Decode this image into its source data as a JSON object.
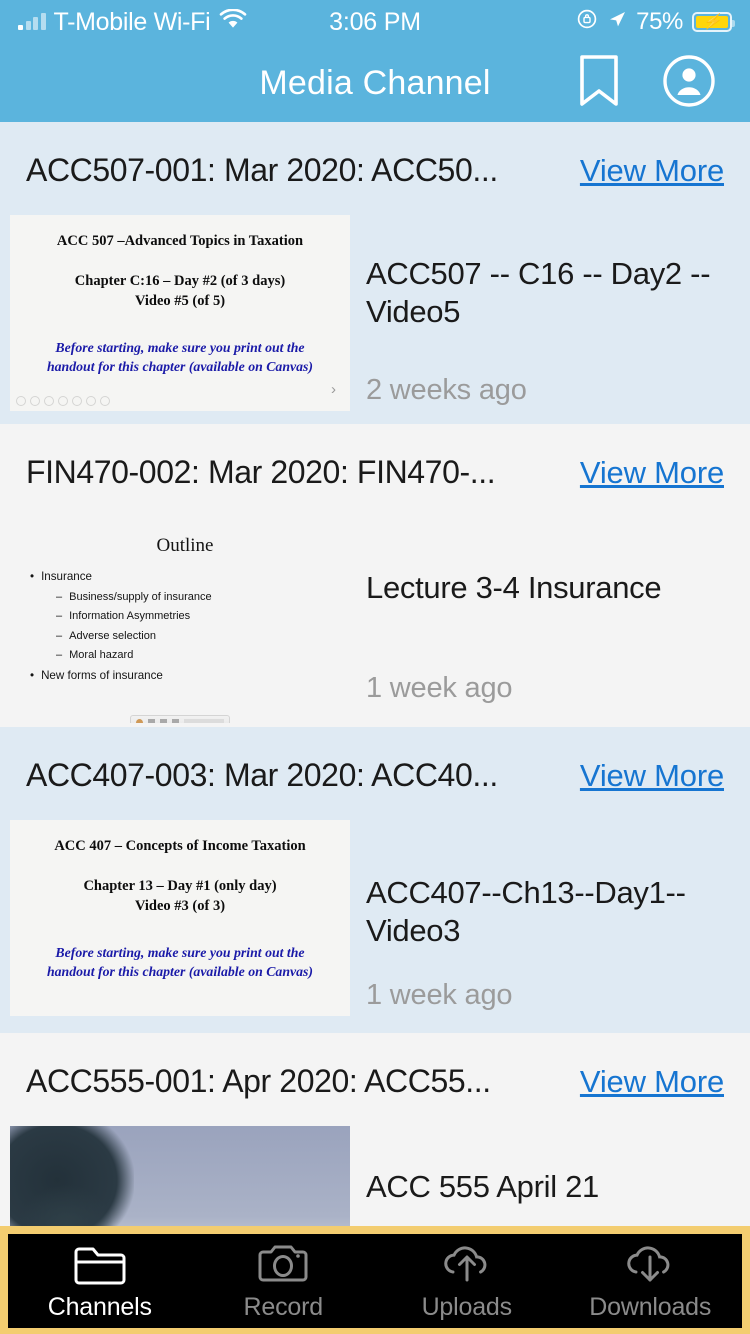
{
  "status_bar": {
    "carrier": "T-Mobile Wi-Fi",
    "time": "3:06 PM",
    "battery_percent": "75%",
    "icons": [
      "signal-bars-icon",
      "wifi-icon",
      "rotation-lock-icon",
      "location-arrow-icon",
      "battery-charging-icon"
    ]
  },
  "nav": {
    "title": "Media Channel",
    "bookmark_icon": "bookmark-icon",
    "account_icon": "account-avatar-icon"
  },
  "cards": [
    {
      "title": "ACC507-001: Mar 2020: ACC50...",
      "view_more": "View More",
      "video_title": "ACC507 -- C16 -- Day2 -- Video5",
      "age": "2 weeks ago",
      "thumb_type": "slide",
      "slide": {
        "line1": "ACC 507 –Advanced Topics in Taxation",
        "line2": "Chapter C:16 – Day #2 (of 3 days)",
        "line3": "Video #5 (of 5)",
        "note_line1": "Before starting, make sure you print out the",
        "note_line2": "handout for this chapter (available on Canvas)"
      }
    },
    {
      "title": "FIN470-002: Mar 2020: FIN470-...",
      "view_more": "View More",
      "video_title": "Lecture 3-4 Insurance",
      "age": "1 week ago",
      "thumb_type": "outline",
      "outline": {
        "heading": "Outline",
        "items": [
          {
            "text": "Insurance",
            "level": 1
          },
          {
            "text": "Business/supply of insurance",
            "level": 2
          },
          {
            "text": "Information Asymmetries",
            "level": 2
          },
          {
            "text": "Adverse selection",
            "level": 2
          },
          {
            "text": "Moral hazard",
            "level": 2
          },
          {
            "text": "New forms of insurance",
            "level": 1
          }
        ]
      }
    },
    {
      "title": "ACC407-003: Mar 2020: ACC40...",
      "view_more": "View More",
      "video_title": "ACC407--Ch13--Day1--Video3",
      "age": "1 week ago",
      "thumb_type": "slide",
      "slide": {
        "line1": "ACC 407 – Concepts of Income Taxation",
        "line2": "Chapter 13 – Day #1 (only day)",
        "line3": "Video #3 (of 3)",
        "note_line1": "Before starting, make sure you print out the",
        "note_line2": "handout for this chapter (available on Canvas)"
      }
    },
    {
      "title": "ACC555-001: Apr 2020: ACC55...",
      "view_more": "View More",
      "video_title": "ACC 555 April 21",
      "age": "",
      "thumb_type": "photo"
    }
  ],
  "tabbar": {
    "tabs": [
      {
        "label": "Channels",
        "icon": "folder-icon",
        "active": true
      },
      {
        "label": "Record",
        "icon": "camera-icon",
        "active": false
      },
      {
        "label": "Uploads",
        "icon": "cloud-upload-icon",
        "active": false
      },
      {
        "label": "Downloads",
        "icon": "cloud-download-icon",
        "active": false
      }
    ]
  },
  "colors": {
    "header": "#5bb4dd",
    "card_tint": "#dfeaf3",
    "card_plain": "#f4f4f4",
    "link": "#1675d1",
    "tabbar_border": "#f3cd70",
    "tabbar_bg": "#000000",
    "battery": "#ffd60a"
  }
}
